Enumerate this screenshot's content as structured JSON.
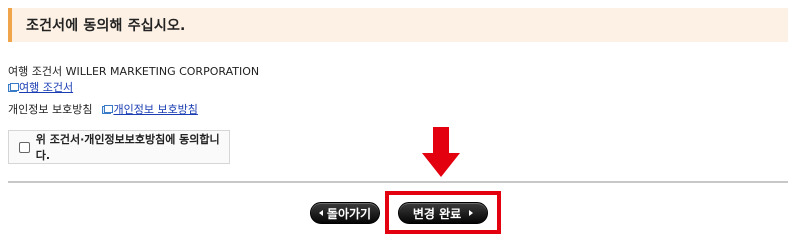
{
  "notice": {
    "text": "조건서에 동의해 주십시오."
  },
  "terms": {
    "heading": "여행 조건서 WILLER MARKETING CORPORATION",
    "link_label": "여행 조건서"
  },
  "privacy": {
    "label": "개인정보 보호방침",
    "link_label": "개인정보 보호방침"
  },
  "agreement": {
    "checkbox_label": "위 조건서·개인정보보호방침에 동의합니다.",
    "checked": false
  },
  "buttons": {
    "back_label": "돌아가기",
    "confirm_label": "변경 완료"
  },
  "colors": {
    "banner_bg": "#fcf1e4",
    "banner_accent": "#f0a54a",
    "link": "#1a3db3",
    "annotation_red": "#e3000f",
    "button_bg": "#111111"
  }
}
